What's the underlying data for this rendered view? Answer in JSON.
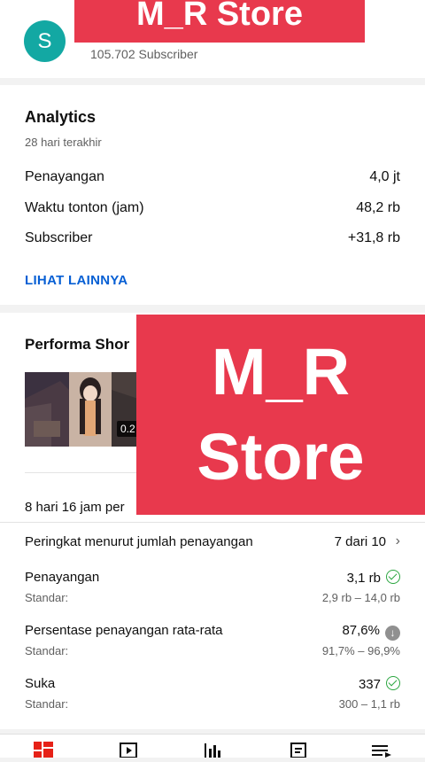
{
  "channel": {
    "avatar_letter": "S",
    "subscribers": "105.702 Subscriber",
    "avatar_color": "#13a8a3"
  },
  "watermark": {
    "top_text": "M_R Store",
    "big_line1": "M_R",
    "big_line2": "Store",
    "color": "#e8394d"
  },
  "analytics": {
    "title": "Analytics",
    "period": "28 hari terakhir",
    "rows": [
      {
        "label": "Penayangan",
        "value": "4,0 jt"
      },
      {
        "label": "Waktu tonton (jam)",
        "value": "48,2 rb"
      },
      {
        "label": "Subscriber",
        "value": "+31,8 rb"
      }
    ],
    "more_link": "LIHAT LAINNYA",
    "link_color": "#065fd4"
  },
  "shorts": {
    "title": "Performa Shor",
    "thumb_duration": "0.2",
    "age_text": "8 hari 16 jam per",
    "ranking": {
      "label": "Peringkat menurut jumlah penayangan",
      "value": "7 dari 10"
    },
    "metrics": [
      {
        "label": "Penayangan",
        "value": "3,1 rb",
        "std_label": "Standar:",
        "std_range": "2,9 rb – 14,0 rb",
        "status_icon": "check-circle-icon"
      },
      {
        "label": "Persentase penayangan rata-rata",
        "value": "87,6%",
        "std_label": "Standar:",
        "std_range": "91,7% – 96,9%",
        "status_icon": "arrow-down-circle-icon"
      },
      {
        "label": "Suka",
        "value": "337",
        "std_label": "Standar:",
        "std_range": "300 – 1,1 rb",
        "status_icon": "check-circle-icon"
      }
    ],
    "good_color": "#2ba640"
  },
  "bottom_nav": {
    "icons": [
      "dashboard-icon",
      "content-icon",
      "analytics-icon",
      "comments-icon",
      "playlist-icon"
    ],
    "active_color": "#e62117"
  }
}
